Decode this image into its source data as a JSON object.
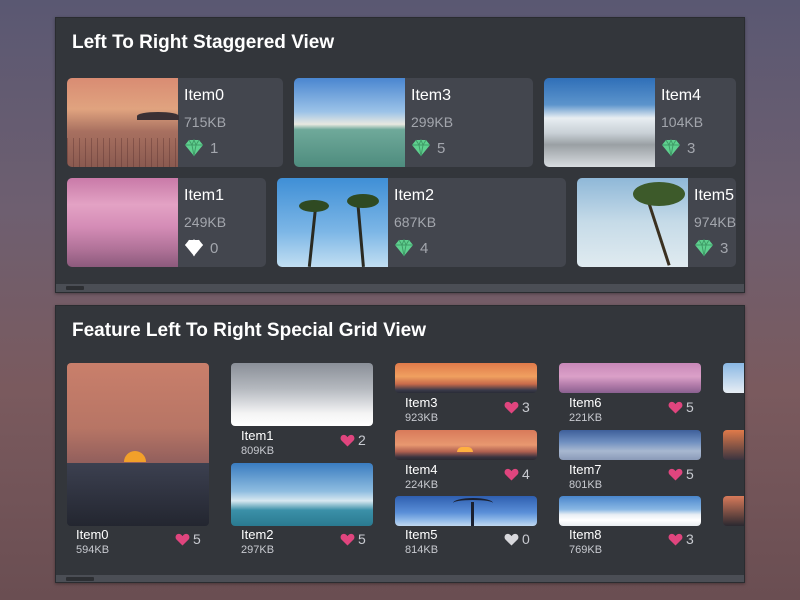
{
  "staggered": {
    "title": "Left To Right Staggered View",
    "items": [
      {
        "name": "Item0",
        "size": "715KB",
        "count": "1"
      },
      {
        "name": "Item1",
        "size": "249KB",
        "count": "0"
      },
      {
        "name": "Item2",
        "size": "687KB",
        "count": "4"
      },
      {
        "name": "Item3",
        "size": "299KB",
        "count": "5"
      },
      {
        "name": "Item4",
        "size": "104KB",
        "count": "3"
      },
      {
        "name": "Item5",
        "size": "974KB",
        "count": "3"
      }
    ]
  },
  "grid": {
    "title": "Feature Left To Right Special Grid View",
    "items": [
      {
        "name": "Item0",
        "size": "594KB",
        "likes": "5"
      },
      {
        "name": "Item1",
        "size": "809KB",
        "likes": "2"
      },
      {
        "name": "Item2",
        "size": "297KB",
        "likes": "5"
      },
      {
        "name": "Item3",
        "size": "923KB",
        "likes": "3"
      },
      {
        "name": "Item4",
        "size": "224KB",
        "likes": "4"
      },
      {
        "name": "Item5",
        "size": "814KB",
        "likes": "0"
      },
      {
        "name": "Item6",
        "size": "221KB",
        "likes": "5"
      },
      {
        "name": "Item7",
        "size": "801KB",
        "likes": "5"
      },
      {
        "name": "Item8",
        "size": "769KB",
        "likes": "3"
      }
    ]
  },
  "colors": {
    "gem": "#5fd08f",
    "heart_active": "#e0457e",
    "heart_inactive": "#d8d8dc",
    "panel_bg": "#33363b",
    "card_bg": "#43464e"
  },
  "icons": {
    "gem": "diamond-icon",
    "heart": "heart-icon"
  }
}
